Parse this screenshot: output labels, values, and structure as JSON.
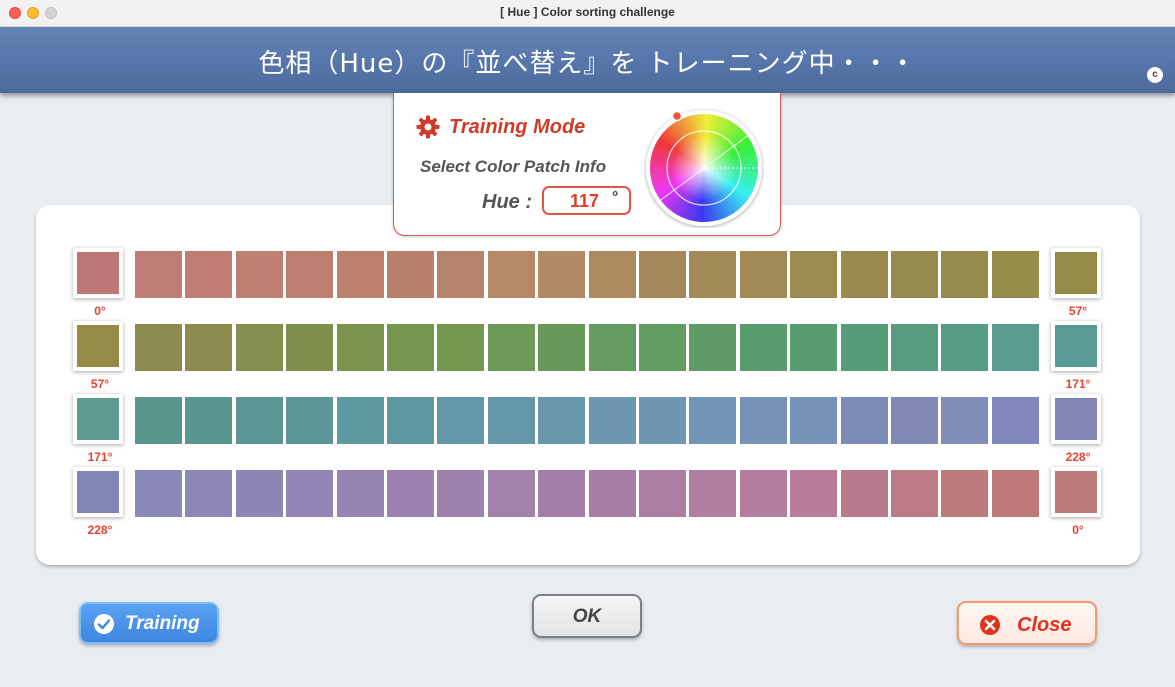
{
  "window": {
    "title": "[ Hue ] Color sorting challenge"
  },
  "header": {
    "title": "色相（Hue）の『並べ替え』を トレーニング中・・・",
    "badge": "c"
  },
  "info_card": {
    "mode_label": "Training Mode",
    "patch_info_label": "Select Color Patch Info",
    "hue_label": "Hue :",
    "hue_value": "117",
    "hue_unit": "°"
  },
  "rows": [
    {
      "start_label": "0°",
      "end_label": "57°",
      "start_color": "#bd7775",
      "end_color": "#958b46",
      "colors": [
        "#bf7d77",
        "#c07d74",
        "#bf7f73",
        "#be7f71",
        "#bd806f",
        "#b9806c",
        "#b6846a",
        "#b68867",
        "#b08a62",
        "#ad8b5e",
        "#a5885a",
        "#a38b59",
        "#a18a56",
        "#9c8b51",
        "#998b4e",
        "#978c4d",
        "#968b4c",
        "#968c4c"
      ]
    },
    {
      "start_label": "57°",
      "end_label": "171°",
      "start_color": "#958b46",
      "end_color": "#599c95",
      "colors": [
        "#8c8a4d",
        "#8b8c4e",
        "#868e4f",
        "#7f904d",
        "#7a944f",
        "#76964f",
        "#74984f",
        "#6d9a56",
        "#68995a",
        "#649b5e",
        "#619c61",
        "#5e9b66",
        "#5a9b6d",
        "#589c72",
        "#579c78",
        "#589c7f",
        "#589c88",
        "#5a9c8f"
      ]
    },
    {
      "start_label": "171°",
      "end_label": "228°",
      "start_color": "#5c9c8e",
      "end_color": "#8284b6",
      "colors": [
        "#5a968e",
        "#5a9690",
        "#5b9695",
        "#5c9698",
        "#5d999e",
        "#5f97a1",
        "#6197a6",
        "#6497a9",
        "#6798ab",
        "#6d96af",
        "#6f96b0",
        "#7195b4",
        "#7594b5",
        "#7792b7",
        "#7b8cb7",
        "#808ab4",
        "#818db7",
        "#8188bb"
      ]
    },
    {
      "start_label": "228°",
      "end_label": "0°",
      "start_color": "#8086b3",
      "end_color": "#bc7a78",
      "colors": [
        "#8b89b9",
        "#8d87b5",
        "#8f84b6",
        "#9284b5",
        "#9684b2",
        "#9c82b0",
        "#9f81ad",
        "#a281aa",
        "#a57fa9",
        "#a97ea5",
        "#ae7ea2",
        "#b07f9f",
        "#b47d9e",
        "#b87b98",
        "#ba7a8e",
        "#bc7b86",
        "#bd7b7e",
        "#bd7a79"
      ]
    }
  ],
  "buttons": {
    "training_label": "Training",
    "ok_label": "OK",
    "close_label": "Close"
  },
  "icons": {
    "gear": "gear-icon",
    "check": "check-circle-icon",
    "close": "close-circle-icon",
    "wheel": "hue-wheel-icon"
  },
  "colors": {
    "accent_red": "#e0321e",
    "banner_blue": "#5675aa",
    "training_blue": "#3f86e0"
  }
}
